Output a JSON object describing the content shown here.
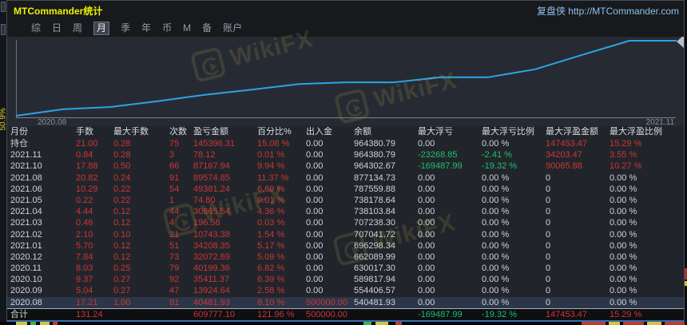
{
  "window": {
    "title": "MTCommander统计",
    "brand_link": "复盘侠 http://MTCommander.com"
  },
  "menu": {
    "items": [
      "综",
      "日",
      "周",
      "月",
      "季",
      "年",
      "币",
      "M",
      "备",
      "账户"
    ],
    "active": "月"
  },
  "side_label": "50.9%",
  "watermark_text": "WikiFX",
  "colors": {
    "red": "#cf3434",
    "green": "#1fbf6e",
    "white": "#ced3d9",
    "line_blue": "#2aa4e4",
    "title_yellow": "#f0f000"
  },
  "chart_data": {
    "type": "line",
    "title": "",
    "xlabel": "",
    "ylabel": "",
    "x_axis_labels": [
      "2020.08",
      "2021.11"
    ],
    "x": [
      "2020.08",
      "2020.09",
      "2020.10",
      "2020.11",
      "2020.12",
      "2021.01",
      "2021.02",
      "2021.03",
      "2021.04",
      "2021.05",
      "2021.06",
      "2021.08",
      "2021.10",
      "2021.11"
    ],
    "start_value": 500000,
    "series": [
      {
        "name": "余额",
        "values": [
          540481.93,
          554406.57,
          589817.94,
          630017.3,
          662089.99,
          696298.34,
          707041.72,
          707238.3,
          738103.84,
          738178.64,
          787559.88,
          877134.73,
          964302.67,
          964380.79
        ]
      }
    ],
    "ylim": [
      500000,
      980000
    ],
    "grid": false,
    "legend": "none",
    "line_color": "#2aa4e4"
  },
  "table": {
    "columns": [
      "月份",
      "手数",
      "最大手数",
      "次数",
      "盈亏金额",
      "百分比%",
      "出入金",
      "余额",
      "最大浮亏",
      "最大浮亏比例",
      "最大浮盈金额",
      "最大浮盈比例"
    ],
    "rows": [
      {
        "cells": [
          "持仓",
          "21.00",
          "0.28",
          "75",
          "145396.31",
          "15.08 %",
          "0.00",
          "964380.79",
          "0.00",
          "0.00 %",
          "147453.47",
          "15.29 %"
        ],
        "colors": [
          "w",
          "r",
          "r",
          "r",
          "r",
          "r",
          "w",
          "w",
          "w",
          "w",
          "r",
          "r"
        ],
        "selected": false
      },
      {
        "cells": [
          "2021.11",
          "0.84",
          "0.28",
          "3",
          "78.12",
          "0.01 %",
          "0.00",
          "964380.79",
          "-23268.85",
          "-2.41 %",
          "34203.47",
          "3.55 %"
        ],
        "colors": [
          "w",
          "r",
          "r",
          "r",
          "r",
          "r",
          "w",
          "w",
          "g",
          "g",
          "r",
          "r"
        ],
        "selected": false
      },
      {
        "cells": [
          "2021.10",
          "17.88",
          "0.50",
          "66",
          "87167.94",
          "9.94 %",
          "0.00",
          "964302.67",
          "-169487.99",
          "-19.32 %",
          "90065.88",
          "10.27 %"
        ],
        "colors": [
          "w",
          "r",
          "r",
          "r",
          "r",
          "r",
          "w",
          "w",
          "g",
          "g",
          "r",
          "r"
        ],
        "selected": false
      },
      {
        "cells": [
          "2021.08",
          "20.82",
          "0.24",
          "91",
          "89574.85",
          "11.37 %",
          "0.00",
          "877134.73",
          "0.00",
          "0.00 %",
          "0",
          "0.00 %"
        ],
        "colors": [
          "w",
          "r",
          "r",
          "r",
          "r",
          "r",
          "w",
          "w",
          "w",
          "w",
          "w",
          "w"
        ],
        "selected": false
      },
      {
        "cells": [
          "2021.06",
          "10.29",
          "0.22",
          "54",
          "49381.24",
          "6.69 %",
          "0.00",
          "787559.88",
          "0.00",
          "0.00 %",
          "0",
          "0.00 %"
        ],
        "colors": [
          "w",
          "r",
          "r",
          "r",
          "r",
          "r",
          "w",
          "w",
          "w",
          "w",
          "w",
          "w"
        ],
        "selected": false
      },
      {
        "cells": [
          "2021.05",
          "0.22",
          "0.22",
          "1",
          "74.80",
          "0.01 %",
          "0.00",
          "738178.64",
          "0.00",
          "0.00 %",
          "0",
          "0.00 %"
        ],
        "colors": [
          "w",
          "r",
          "r",
          "r",
          "r",
          "r",
          "w",
          "w",
          "w",
          "w",
          "w",
          "w"
        ],
        "selected": false
      },
      {
        "cells": [
          "2021.04",
          "4.44",
          "0.12",
          "44",
          "30865.54",
          "4.36 %",
          "0.00",
          "738103.84",
          "0.00",
          "0.00 %",
          "0",
          "0.00 %"
        ],
        "colors": [
          "w",
          "r",
          "r",
          "r",
          "r",
          "r",
          "w",
          "w",
          "w",
          "w",
          "w",
          "w"
        ],
        "selected": false
      },
      {
        "cells": [
          "2021.03",
          "0.46",
          "0.12",
          "4",
          "196.58",
          "0.03 %",
          "0.00",
          "707238.30",
          "0.00",
          "0.00 %",
          "0",
          "0.00 %"
        ],
        "colors": [
          "w",
          "r",
          "r",
          "r",
          "r",
          "r",
          "w",
          "w",
          "w",
          "w",
          "w",
          "w"
        ],
        "selected": false
      },
      {
        "cells": [
          "2021.02",
          "2.10",
          "0.10",
          "21",
          "10743.38",
          "1.54 %",
          "0.00",
          "707041.72",
          "0.00",
          "0.00 %",
          "0",
          "0.00 %"
        ],
        "colors": [
          "w",
          "r",
          "r",
          "r",
          "r",
          "r",
          "w",
          "w",
          "w",
          "w",
          "w",
          "w"
        ],
        "selected": false
      },
      {
        "cells": [
          "2021.01",
          "5.70",
          "0.12",
          "51",
          "34208.35",
          "5.17 %",
          "0.00",
          "696298.34",
          "0.00",
          "0.00 %",
          "0",
          "0.00 %"
        ],
        "colors": [
          "w",
          "r",
          "r",
          "r",
          "r",
          "r",
          "w",
          "w",
          "w",
          "w",
          "w",
          "w"
        ],
        "selected": false
      },
      {
        "cells": [
          "2020.12",
          "7.84",
          "0.12",
          "73",
          "32072.69",
          "5.09 %",
          "0.00",
          "662089.99",
          "0.00",
          "0.00 %",
          "0",
          "0.00 %"
        ],
        "colors": [
          "w",
          "r",
          "r",
          "r",
          "r",
          "r",
          "w",
          "w",
          "w",
          "w",
          "w",
          "w"
        ],
        "selected": false
      },
      {
        "cells": [
          "2020.11",
          "8.03",
          "0.25",
          "79",
          "40199.36",
          "6.82 %",
          "0.00",
          "630017.30",
          "0.00",
          "0.00 %",
          "0",
          "0.00 %"
        ],
        "colors": [
          "w",
          "r",
          "r",
          "r",
          "r",
          "r",
          "w",
          "w",
          "w",
          "w",
          "w",
          "w"
        ],
        "selected": false
      },
      {
        "cells": [
          "2020.10",
          "9.37",
          "0.27",
          "92",
          "35411.37",
          "6.39 %",
          "0.00",
          "589817.94",
          "0.00",
          "0.00 %",
          "0",
          "0.00 %"
        ],
        "colors": [
          "w",
          "r",
          "r",
          "r",
          "r",
          "r",
          "w",
          "w",
          "w",
          "w",
          "w",
          "w"
        ],
        "selected": false
      },
      {
        "cells": [
          "2020.09",
          "5.04",
          "0.27",
          "47",
          "13924.64",
          "2.58 %",
          "0.00",
          "554406.57",
          "0.00",
          "0.00 %",
          "0",
          "0.00 %"
        ],
        "colors": [
          "w",
          "r",
          "r",
          "r",
          "r",
          "r",
          "w",
          "w",
          "w",
          "w",
          "w",
          "w"
        ],
        "selected": false
      },
      {
        "cells": [
          "2020.08",
          "17.21",
          "1.00",
          "81",
          "40481.93",
          "8.10 %",
          "500000.00",
          "540481.93",
          "0.00",
          "0.00 %",
          "0",
          "0.00 %"
        ],
        "colors": [
          "w",
          "r",
          "r",
          "r",
          "r",
          "r",
          "r",
          "w",
          "w",
          "w",
          "w",
          "w"
        ],
        "selected": true
      }
    ],
    "total": {
      "cells": [
        "合计",
        "131.24",
        "",
        "",
        "609777.10",
        "121.96 %",
        "500000.00",
        "",
        "-169487.99",
        "-19.32 %",
        "147453.47",
        "15.29 %"
      ],
      "colors": [
        "w",
        "r",
        "w",
        "w",
        "r",
        "r",
        "r",
        "w",
        "g",
        "g",
        "r",
        "r"
      ]
    }
  }
}
